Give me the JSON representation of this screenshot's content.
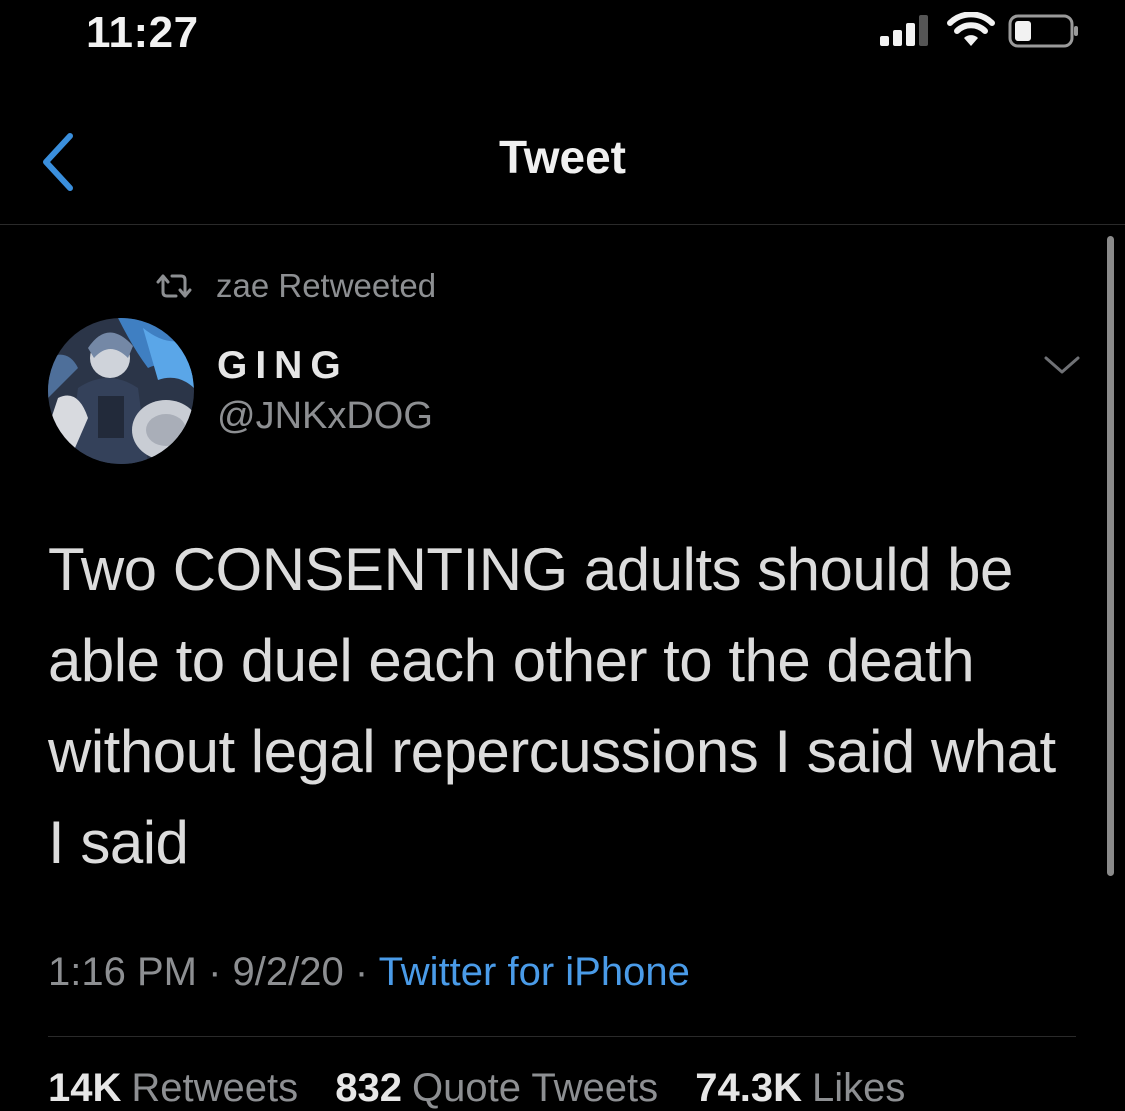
{
  "status_bar": {
    "time": "11:27",
    "icons": [
      "cellular-signal-icon",
      "wifi-icon",
      "battery-icon"
    ]
  },
  "nav": {
    "title": "Tweet",
    "back_icon": "chevron-left-icon"
  },
  "retweet_context": {
    "icon": "retweet-icon",
    "text": "zae Retweeted"
  },
  "author": {
    "display_name": "GING",
    "handle": "@JNKxDOG",
    "more_icon": "chevron-down-icon"
  },
  "tweet": {
    "text": "Two CONSENTING adults should be able to duel each other to the death without legal repercussions I said what I said"
  },
  "meta": {
    "time": "1:16 PM",
    "date": "9/2/20",
    "separator": " · ",
    "source": "Twitter for iPhone"
  },
  "stats": {
    "retweets": {
      "count": "14K",
      "label": "Retweets"
    },
    "quotes": {
      "count": "832",
      "label": "Quote Tweets"
    },
    "likes": {
      "count": "74.3K",
      "label": "Likes"
    }
  },
  "colors": {
    "background": "#000000",
    "link": "#4a9be8",
    "muted": "#8d8f92",
    "text": "#dcdcdc"
  }
}
